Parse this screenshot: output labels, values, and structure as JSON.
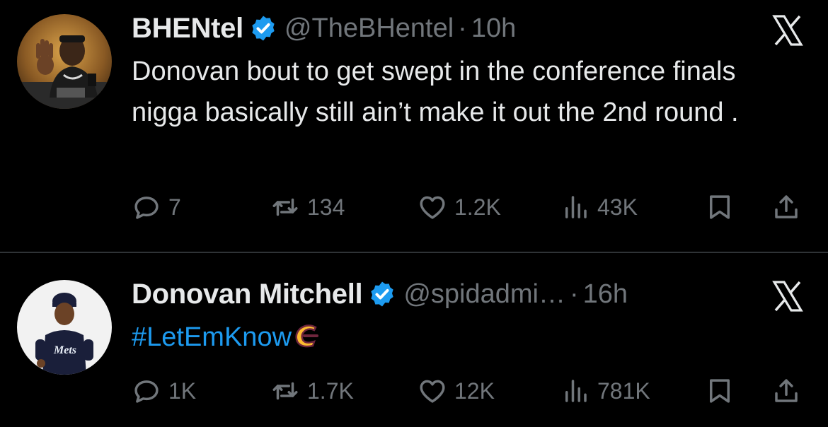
{
  "colors": {
    "background": "#000000",
    "text": "#e7e9ea",
    "secondary": "#71767b",
    "link": "#1d9bf0",
    "verified": "#1d9bf0",
    "divider": "#2f3336"
  },
  "tweets": [
    {
      "name": "BHENtel",
      "handle": "@TheBHentel",
      "separator": "·",
      "time": "10h",
      "text": "Donovan bout to get swept in the conference finals nigga basically still ain’t make it out the 2nd round .",
      "hashtag": "",
      "avatar_icon": "avatar-photo",
      "stats": {
        "replies": "7",
        "retweets": "134",
        "likes": "1.2K",
        "views": "43K"
      }
    },
    {
      "name": "Donovan Mitchell",
      "handle": "@spidadmi…",
      "separator": "·",
      "time": "16h",
      "text": "",
      "hashtag": "#LetEmKnow",
      "hashtag_icon": "cavaliers-logo-icon",
      "avatar_icon": "avatar-photo",
      "stats": {
        "replies": "1K",
        "retweets": "1.7K",
        "likes": "12K",
        "views": "781K"
      }
    }
  ],
  "icons": [
    "verified-badge-icon",
    "x-logo-icon",
    "reply-icon",
    "retweet-icon",
    "like-icon",
    "views-icon",
    "bookmark-icon",
    "share-icon"
  ]
}
